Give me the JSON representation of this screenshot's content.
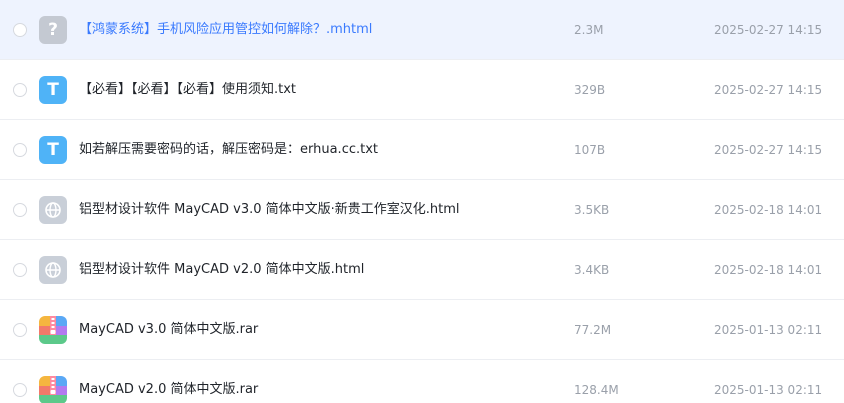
{
  "files": [
    {
      "name": "【鸿蒙系统】手机风险应用管控如何解除？.mhtml",
      "size": "2.3M",
      "date": "2025-02-27 14:15",
      "icon": "unknown-file-icon",
      "selected": true
    },
    {
      "name": "【必看】【必看】【必看】使用须知.txt",
      "size": "329B",
      "date": "2025-02-27 14:15",
      "icon": "text-file-icon",
      "selected": false
    },
    {
      "name": "如若解压需要密码的话，解压密码是：erhua.cc.txt",
      "size": "107B",
      "date": "2025-02-27 14:15",
      "icon": "text-file-icon",
      "selected": false
    },
    {
      "name": "铝型材设计软件 MayCAD v3.0 简体中文版·新贵工作室汉化.html",
      "size": "3.5KB",
      "date": "2025-02-18 14:01",
      "icon": "web-file-icon",
      "selected": false
    },
    {
      "name": "铝型材设计软件 MayCAD v2.0 简体中文版.html",
      "size": "3.4KB",
      "date": "2025-02-18 14:01",
      "icon": "web-file-icon",
      "selected": false
    },
    {
      "name": "MayCAD v3.0 简体中文版.rar",
      "size": "77.2M",
      "date": "2025-01-13 02:11",
      "icon": "archive-file-icon",
      "selected": false
    },
    {
      "name": "MayCAD v2.0 简体中文版.rar",
      "size": "128.4M",
      "date": "2025-01-13 02:11",
      "icon": "archive-file-icon",
      "selected": false
    }
  ],
  "icon_glyphs": {
    "unknown": "?",
    "text": "T"
  },
  "colors": {
    "accent": "#3a7afe",
    "selected_row": "#eef3fe",
    "text_icon": "#4fb3f7",
    "muted": "#9aa0aa"
  }
}
